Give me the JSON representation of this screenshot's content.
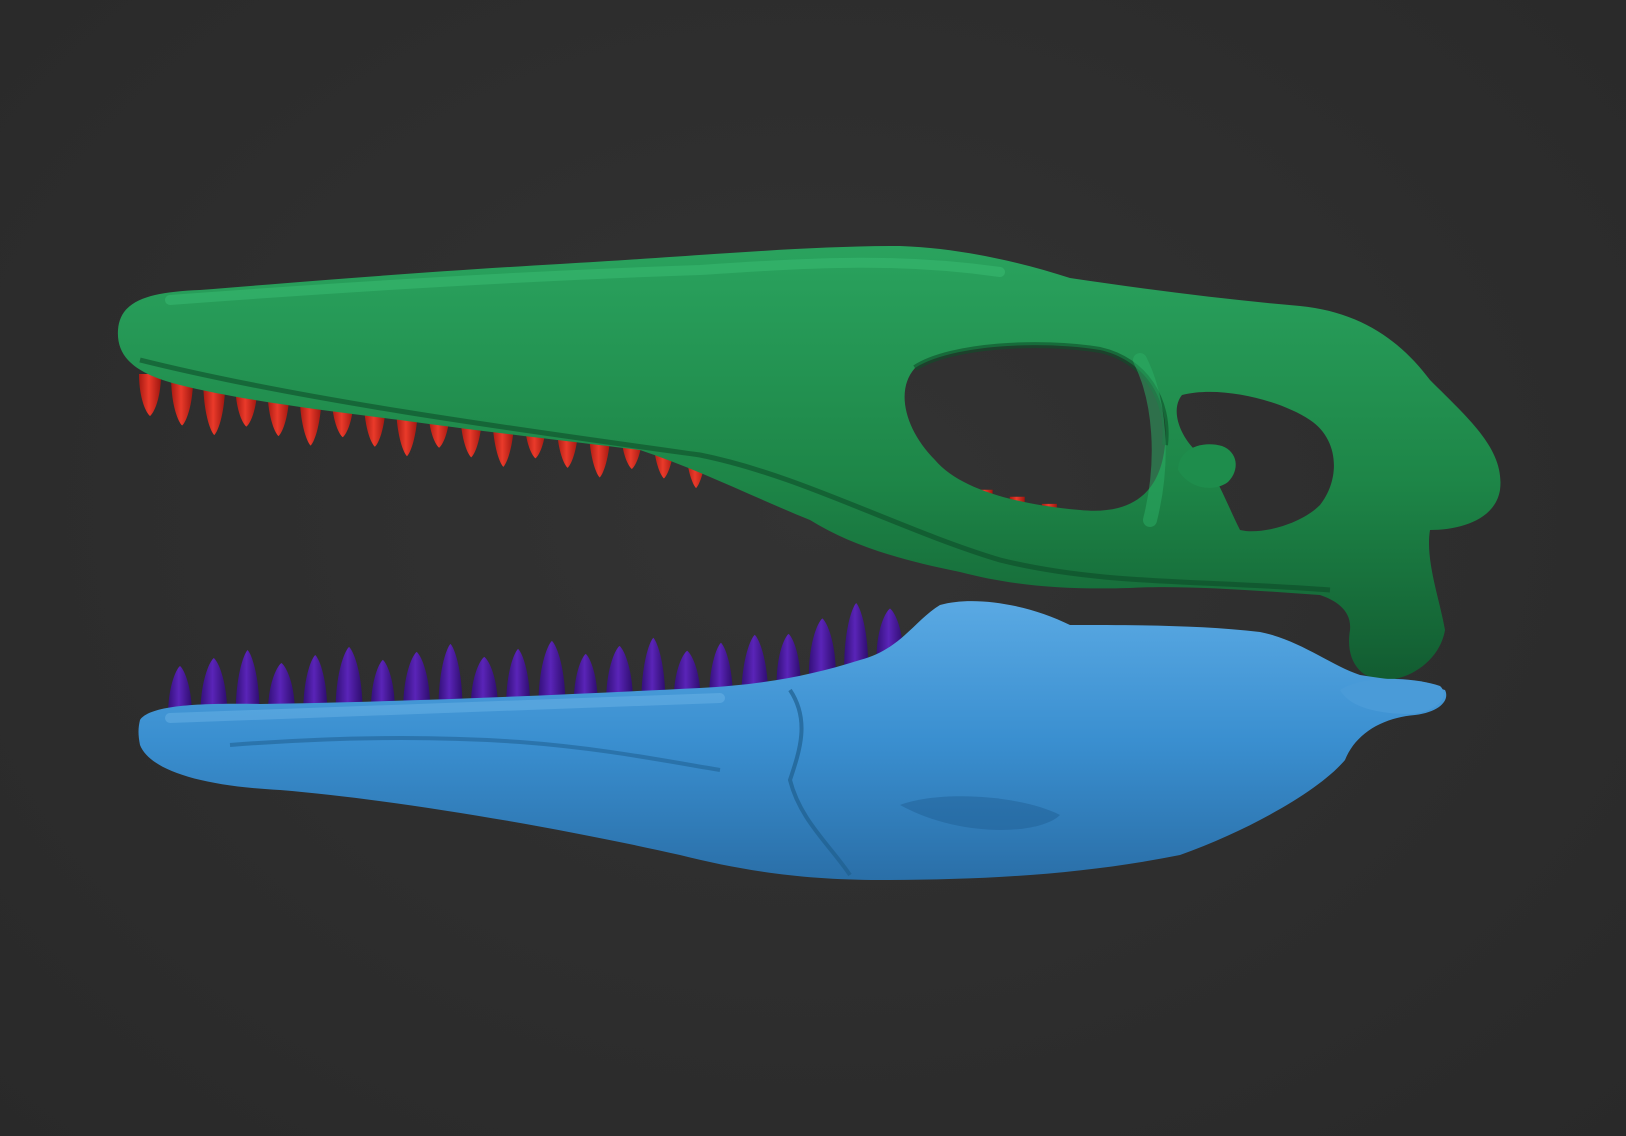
{
  "scene": {
    "background_color": "#2e2e2e",
    "parts": [
      {
        "name": "upper-skull",
        "color": "#1f8a4c"
      },
      {
        "name": "upper-teeth",
        "color": "#d8281c"
      },
      {
        "name": "lower-jaw",
        "color": "#3a8fd0"
      },
      {
        "name": "lower-teeth",
        "color": "#4b1aa0"
      }
    ],
    "upper_teeth_count": 34,
    "lower_teeth_count": 22
  }
}
